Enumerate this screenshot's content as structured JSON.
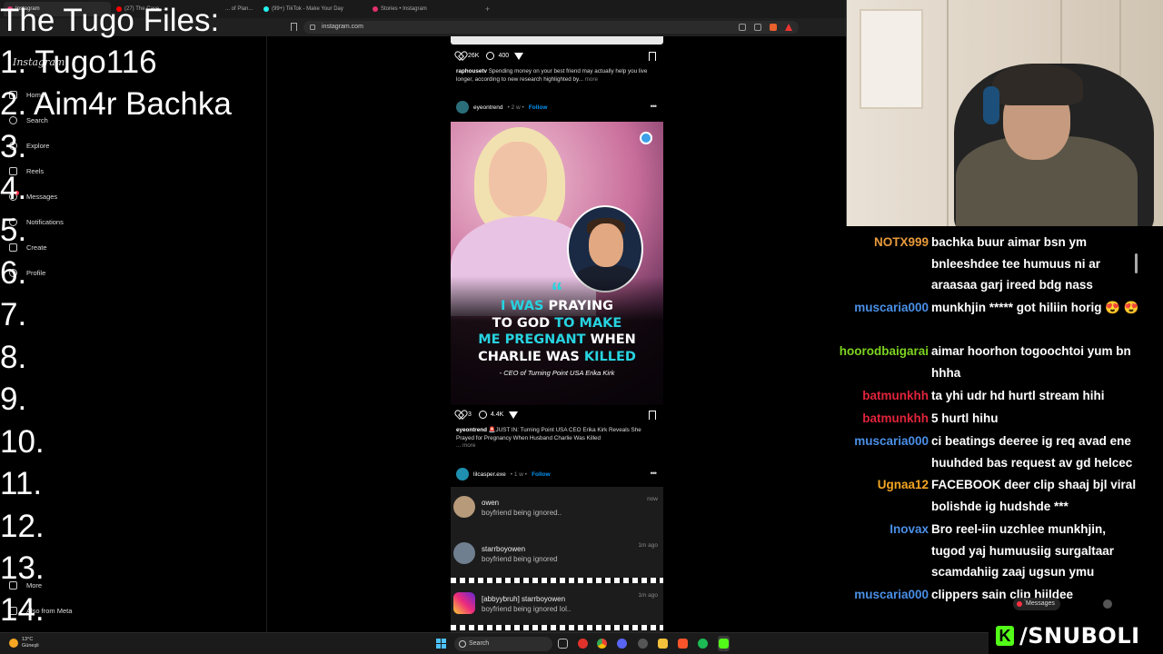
{
  "browser": {
    "tabs": [
      "Instagram",
      "(27) The Cave ...",
      "... of Plan...",
      "(99+) TikTok - Make Your Day",
      "Stories • Instagram"
    ],
    "new_tab": "+",
    "url": "instagram.com"
  },
  "overlay": {
    "title": "The Tugo Files:",
    "items": [
      "1. Tugo116",
      "2. Aim4r Bachka",
      "3.",
      "4.",
      "5.",
      "6.",
      "7.",
      "8.",
      "9.",
      "10.",
      "11.",
      "12.",
      "13.",
      "14."
    ]
  },
  "ig_sidebar": {
    "logo": "Instagram",
    "items": [
      "Home",
      "Search",
      "Explore",
      "Reels",
      "Messages",
      "Notifications",
      "Create",
      "Profile"
    ],
    "more": "More",
    "meta": "Also from Meta"
  },
  "feed": {
    "post1": {
      "likes": "26K",
      "comments": "400",
      "user": "raphousetv",
      "caption": "Spending money on your best friend may actually help you live longer, according to new research highlighted by...",
      "more": "more"
    },
    "post2": {
      "user": "eyeontrend",
      "meta": "• 2 w •",
      "follow": "Follow",
      "quote_mark": "“",
      "headline_1a": "I WAS",
      "headline_1b": " PRAYING",
      "headline_2a": "TO GOD ",
      "headline_2b": "TO MAKE",
      "headline_3a": "ME PREGNANT",
      "headline_3b": " WHEN",
      "headline_4a": "CHARLIE WAS ",
      "headline_4b": "KILLED",
      "subline": "- CEO of Turning Point USA Erika Kirk",
      "likes": "3",
      "comments": "4.4K",
      "caption_user": "eyeontrend",
      "caption": "🚨JUST IN: Turning Point USA CEO Erika Kirk Reveals She Prayed for Pregnancy When Husband Charlie Was Killed",
      "more": "... more"
    },
    "post3": {
      "user": "lilcasper.exe",
      "meta": "• 1 w •",
      "follow": "Follow",
      "notifications": [
        {
          "name": "owen",
          "text": "boyfriend being ignored..",
          "time": "now"
        },
        {
          "name": "starrboyowen",
          "text": "boyfriend being ignored",
          "time": "1m ago"
        },
        {
          "name": "[abbyybruh] starrboyowen",
          "text": "boyfriend being ignored lol..",
          "time": "1m ago"
        }
      ]
    }
  },
  "chat": {
    "messages": [
      {
        "user": "NOTX999",
        "color": "#e89a3c",
        "text": "bachka buur aimar bsn ym bnleeshdee tee humuus ni ar araasaa garj ireed bdg nass"
      },
      {
        "user": "muscaria000",
        "color": "#4a8fe7",
        "text": "munkhjin ***** got hiliin horig 😍 😍"
      },
      {
        "user": "hoorodbaigarai",
        "color": "#7ed321",
        "text": "aimar hoorhon togoochtoi yum bn hhha"
      },
      {
        "user": "batmunkhh",
        "color": "#e0243b",
        "text": "ta yhi udr hd hurtl stream hihi"
      },
      {
        "user": "batmunkhh",
        "color": "#e0243b",
        "text": "5 hurtl hihu"
      },
      {
        "user": "muscaria000",
        "color": "#4a8fe7",
        "text": "ci beatings deeree ig req avad ene huuhded bas request av gd helcec"
      },
      {
        "user": "Ugnaa12",
        "color": "#f5a623",
        "text": "FACEBOOK deer clip shaaj bjl viral bolishde ig hudshde ***"
      },
      {
        "user": "Inovax",
        "color": "#4a8fe7",
        "text": "Bro reel-iin uzchlee munkhjin, tugod yaj humuusiig surgaltaar scamdahiig zaaj ugsun ymu"
      },
      {
        "user": "muscaria000",
        "color": "#4a8fe7",
        "text": "clippers sain clip hiildee"
      }
    ],
    "messages_pill": "Messages"
  },
  "brand": {
    "logo": "K",
    "name": "/SNUBOLI"
  },
  "taskbar": {
    "temp": "13°C",
    "weather": "Güneşli",
    "search": "Search"
  }
}
